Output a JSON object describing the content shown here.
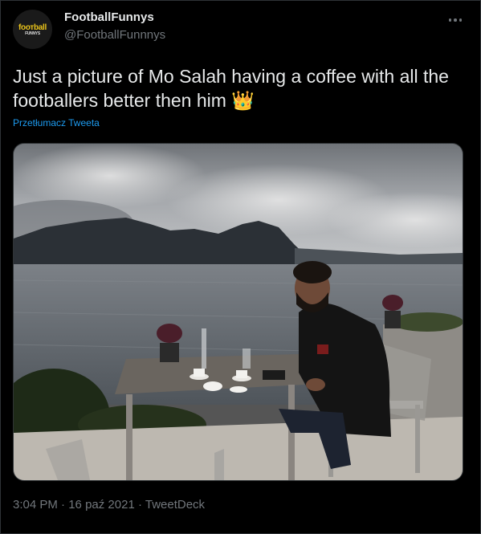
{
  "author": {
    "display_name": "FootballFunnys",
    "handle": "@FootballFunnnys",
    "avatar_text": "foотball",
    "avatar_subtext": "FUNNYS",
    "avatar_icon": "football-funnys-logo"
  },
  "tweet": {
    "text": "Just a picture of Mo Salah having a coffee with all the footballers better then him 👑",
    "translate_label": "Przetłumacz Tweeta",
    "image_icon": "photo-man-at-lakeside-cafe-table"
  },
  "meta": {
    "time": "3:04 PM",
    "separator": " · ",
    "date": "16 paź 2021",
    "source": "TweetDeck"
  },
  "colors": {
    "background": "#000000",
    "text": "#e7e9ea",
    "secondary": "#71767b",
    "link": "#1d9bf0",
    "border": "#2f3336"
  }
}
